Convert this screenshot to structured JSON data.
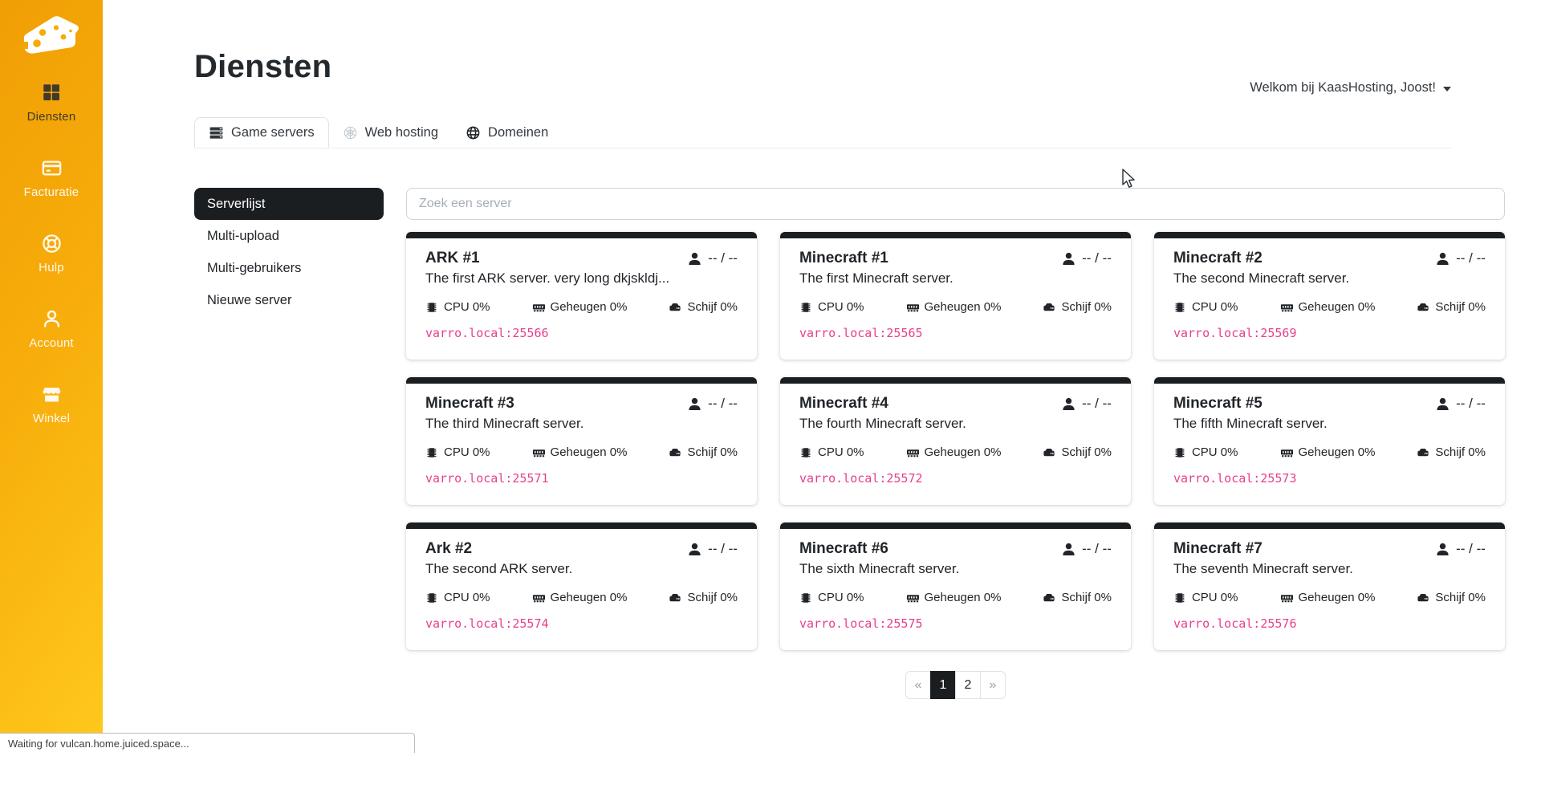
{
  "browser": {
    "status_text": "Waiting for vulcan.home.juiced.space..."
  },
  "header": {
    "page_title": "Diensten",
    "welcome_text": "Welkom bij KaasHosting, Joost!"
  },
  "sidebar": {
    "logo_icon": "cheese-icon",
    "items": [
      {
        "label": "Diensten",
        "icon": "services-grid-icon",
        "active": true
      },
      {
        "label": "Facturatie",
        "icon": "billing-card-icon"
      },
      {
        "label": "Hulp",
        "icon": "help-lifebuoy-icon"
      },
      {
        "label": "Account",
        "icon": "account-user-icon"
      },
      {
        "label": "Winkel",
        "icon": "shop-icon"
      }
    ]
  },
  "tabs": [
    {
      "label": "Game servers",
      "icon": "game-servers-icon",
      "active": true
    },
    {
      "label": "Web hosting",
      "icon": "web-hosting-icon"
    },
    {
      "label": "Domeinen",
      "icon": "domains-globe-icon"
    }
  ],
  "subnav": [
    {
      "label": "Serverlijst",
      "active": true
    },
    {
      "label": "Multi-upload"
    },
    {
      "label": "Multi-gebruikers"
    },
    {
      "label": "Nieuwe server"
    }
  ],
  "search": {
    "placeholder": "Zoek een server"
  },
  "servers": [
    {
      "name": "ARK #1",
      "description": "The first ARK server. very long dkjskldj...",
      "players": "-- / --",
      "cpu": "CPU 0%",
      "memory": "Geheugen 0%",
      "disk": "Schijf 0%",
      "address": "varro.local:25566"
    },
    {
      "name": "Minecraft #1",
      "description": "The first Minecraft server.",
      "players": "-- / --",
      "cpu": "CPU 0%",
      "memory": "Geheugen 0%",
      "disk": "Schijf 0%",
      "address": "varro.local:25565"
    },
    {
      "name": "Minecraft #2",
      "description": "The second Minecraft server.",
      "players": "-- / --",
      "cpu": "CPU 0%",
      "memory": "Geheugen 0%",
      "disk": "Schijf 0%",
      "address": "varro.local:25569"
    },
    {
      "name": "Minecraft #3",
      "description": "The third Minecraft server.",
      "players": "-- / --",
      "cpu": "CPU 0%",
      "memory": "Geheugen 0%",
      "disk": "Schijf 0%",
      "address": "varro.local:25571"
    },
    {
      "name": "Minecraft #4",
      "description": "The fourth Minecraft server.",
      "players": "-- / --",
      "cpu": "CPU 0%",
      "memory": "Geheugen 0%",
      "disk": "Schijf 0%",
      "address": "varro.local:25572"
    },
    {
      "name": "Minecraft #5",
      "description": "The fifth Minecraft server.",
      "players": "-- / --",
      "cpu": "CPU 0%",
      "memory": "Geheugen 0%",
      "disk": "Schijf 0%",
      "address": "varro.local:25573"
    },
    {
      "name": "Ark #2",
      "description": "The second ARK server.",
      "players": "-- / --",
      "cpu": "CPU 0%",
      "memory": "Geheugen 0%",
      "disk": "Schijf 0%",
      "address": "varro.local:25574"
    },
    {
      "name": "Minecraft #6",
      "description": "The sixth Minecraft server.",
      "players": "-- / --",
      "cpu": "CPU 0%",
      "memory": "Geheugen 0%",
      "disk": "Schijf 0%",
      "address": "varro.local:25575"
    },
    {
      "name": "Minecraft #7",
      "description": "The seventh Minecraft server.",
      "players": "-- / --",
      "cpu": "CPU 0%",
      "memory": "Geheugen 0%",
      "disk": "Schijf 0%",
      "address": "varro.local:25576"
    }
  ],
  "pagination": [
    {
      "label": "«"
    },
    {
      "label": "1",
      "active": true
    },
    {
      "label": "2"
    },
    {
      "label": "»"
    }
  ],
  "colors": {
    "sidebar_gradient_start": "#f09f04",
    "sidebar_gradient_end": "#ffc91c",
    "dark": "#1b1e21",
    "code_pink": "#e83e8c"
  }
}
